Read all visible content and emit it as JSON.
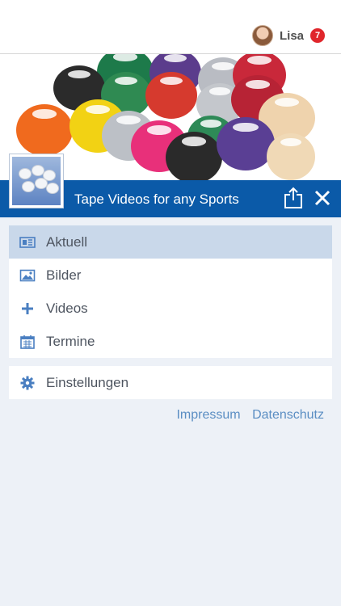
{
  "header": {
    "user_name": "Lisa",
    "notification_count": "7"
  },
  "feed": {
    "title": "Tape Videos for any Sports"
  },
  "menu": {
    "items": [
      {
        "label": "Aktuell",
        "icon": "newspaper-icon",
        "active": true
      },
      {
        "label": "Bilder",
        "icon": "image-icon",
        "active": false
      },
      {
        "label": "Videos",
        "icon": "plus-icon",
        "active": false
      },
      {
        "label": "Termine",
        "icon": "calendar-icon",
        "active": false
      }
    ],
    "settings_label": "Einstellungen"
  },
  "footer": {
    "impressum": "Impressum",
    "datenschutz": "Datenschutz"
  },
  "colors": {
    "accent": "#0b5aa8",
    "active_item": "#c9d8ea",
    "icon": "#4a7fc1",
    "badge": "#e0262b",
    "link": "#5b8ec3"
  }
}
